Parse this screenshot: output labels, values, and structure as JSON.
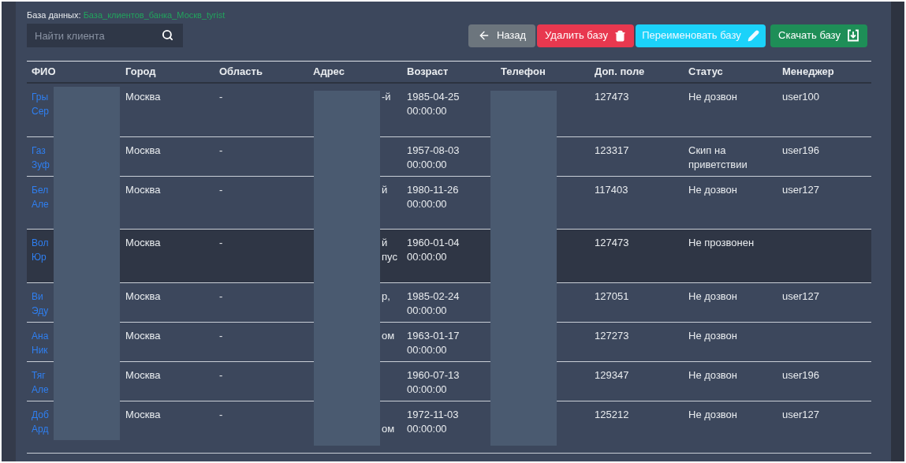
{
  "database": {
    "label": "База данных:",
    "name": "База_клиентов_банка_Москв_tyrist"
  },
  "search": {
    "placeholder": "Найти клиента"
  },
  "buttons": [
    {
      "kind": "back",
      "label": "Назад"
    },
    {
      "kind": "delete",
      "label": "Удалить базу"
    },
    {
      "kind": "rename",
      "label": "Переименовать базу"
    },
    {
      "kind": "download",
      "label": "Скачать базу"
    }
  ],
  "table": {
    "columns": [
      "ФИО",
      "Город",
      "Область",
      "Адрес",
      "Возраст",
      "Телефон",
      "Доп. поле",
      "Статус",
      "Менеджер"
    ],
    "rows": [
      {
        "highlighted": false,
        "name": [
          "Гры",
          "Сер"
        ],
        "city": "Москва",
        "region": "-",
        "address": [
          "-й"
        ],
        "age": [
          "1985-04-25",
          "00:00:00"
        ],
        "extra": "127473",
        "status": "Не дозвон",
        "manager": "user100"
      },
      {
        "highlighted": false,
        "name": [
          "Газ",
          "Зуф"
        ],
        "city": "Москва",
        "region": "-",
        "address": [],
        "age": [
          "1957-08-03",
          "00:00:00"
        ],
        "extra": "123317",
        "status": "Скип на приветствии",
        "manager": "user196"
      },
      {
        "highlighted": false,
        "name": [
          "Бел",
          "Але"
        ],
        "city": "Москва",
        "region": "-",
        "address": [
          "й"
        ],
        "age": [
          "1980-11-26",
          "00:00:00"
        ],
        "extra": "117403",
        "status": "Не дозвон",
        "manager": "user127"
      },
      {
        "highlighted": true,
        "name": [
          "Вол",
          "Юр"
        ],
        "city": "Москва",
        "region": "-",
        "address": [
          "й",
          "пус"
        ],
        "age": [
          "1960-01-04",
          "00:00:00"
        ],
        "extra": "127473",
        "status": "Не прозвонен"
      },
      {
        "highlighted": false,
        "name": [
          "Ви",
          "Эду"
        ],
        "city": "Москва",
        "region": "-",
        "address": [
          "р,"
        ],
        "age": [
          "1985-02-24",
          "00:00:00"
        ],
        "extra": "127051",
        "status": "Не дозвон",
        "manager": "user127"
      },
      {
        "highlighted": false,
        "name": [
          "Ана",
          "Ник"
        ],
        "city": "Москва",
        "region": "-",
        "address": [
          "ом"
        ],
        "age": [
          "1963-01-17",
          "00:00:00"
        ],
        "extra": "127273",
        "status": "Не дозвон"
      },
      {
        "highlighted": false,
        "name": [
          "Тяг",
          "Але"
        ],
        "city": "Москва",
        "region": "-",
        "address": [],
        "age": [
          "1960-07-13",
          "00:00:00"
        ],
        "extra": "129347",
        "status": "Не дозвон",
        "manager": "user196"
      },
      {
        "highlighted": false,
        "name": [
          "Доб",
          "Ард"
        ],
        "city": "Москва",
        "region": "-",
        "address": [
          "ом"
        ],
        "age": [
          "1972-11-03",
          "00:00:00"
        ],
        "extra": "125212",
        "status": "Не дозвон",
        "manager": "user127"
      }
    ]
  }
}
